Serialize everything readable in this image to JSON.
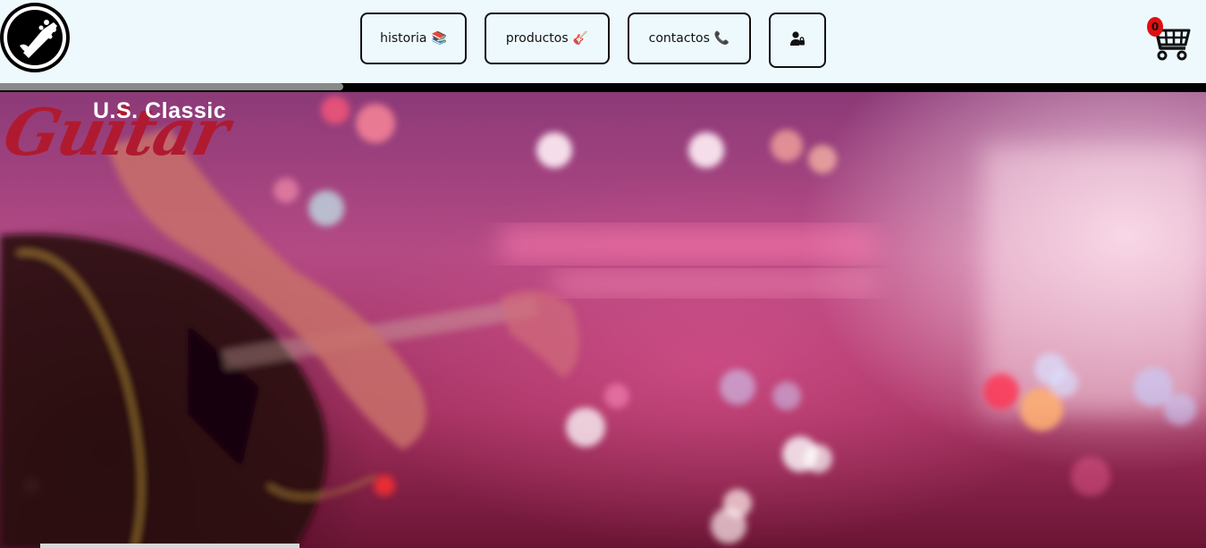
{
  "nav": {
    "historia": {
      "label": "historia",
      "emoji": "📚"
    },
    "productos": {
      "label": "productos",
      "emoji": "🎸"
    },
    "contactos": {
      "label": "contactos",
      "emoji": "📞"
    },
    "login_icon": "user-lock-icon"
  },
  "cart": {
    "count": "0",
    "icon": "shopping-cart-icon"
  },
  "hero": {
    "brand_top": "U.S. Classic",
    "brand_script": "Guitar"
  },
  "colors": {
    "header_bg": "#eef9fe",
    "badge": "#e01010",
    "brand_red": "#b01a30"
  }
}
